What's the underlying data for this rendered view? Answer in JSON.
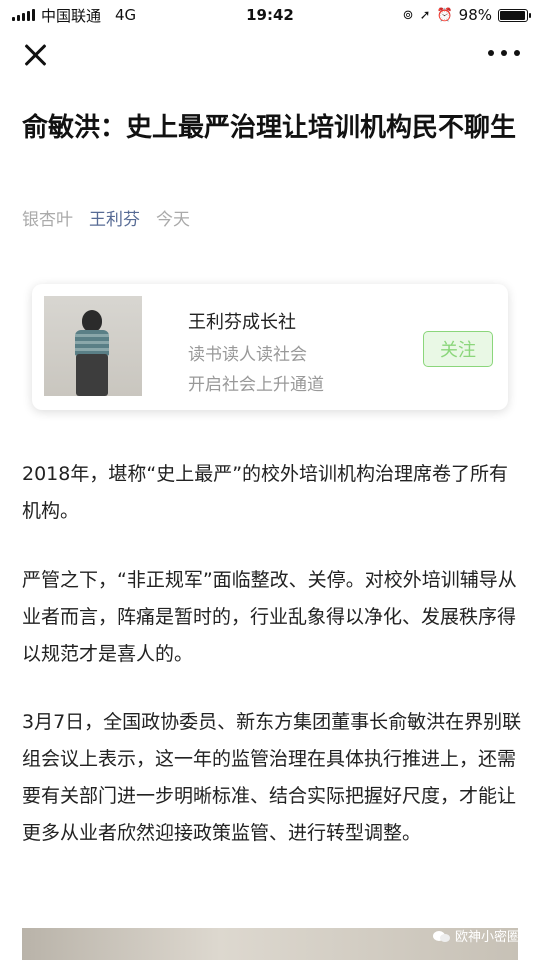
{
  "status_bar": {
    "carrier": "中国联通",
    "network": "4G",
    "time": "19:42",
    "battery": "98%",
    "battery_level": 0.98
  },
  "article": {
    "title": "俞敏洪：史上最严治理让培训机构民不聊生",
    "source": "银杏叶",
    "author": "王利芬",
    "date": "今天",
    "paragraphs": [
      "2018年，堪称“史上最严”的校外培训机构治理席卷了所有机构。",
      "严管之下，“非正规军”面临整改、关停。对校外培训辅导从业者而言，阵痛是暂时的，行业乱象得以净化、发展秩序得以规范才是喜人的。",
      "3月7日，全国政协委员、新东方集团董事长俞敏洪在界别联组会议上表示，这一年的监管治理在具体执行推进上，还需要有关部门进一步明晰标准、结合实际把握好尺度，才能让更多从业者欣然迎接政策监管、进行转型调整。"
    ]
  },
  "profile_card": {
    "name": "王利芬成长社",
    "description": "读书读人读社会\n开启社会上升通道",
    "follow_label": "关注"
  },
  "watermark": {
    "text": "欧神小密圈"
  },
  "colors": {
    "author_link": "#576b95",
    "follow_green": "#8bd67b",
    "meta_gray": "#aaaaaa"
  }
}
